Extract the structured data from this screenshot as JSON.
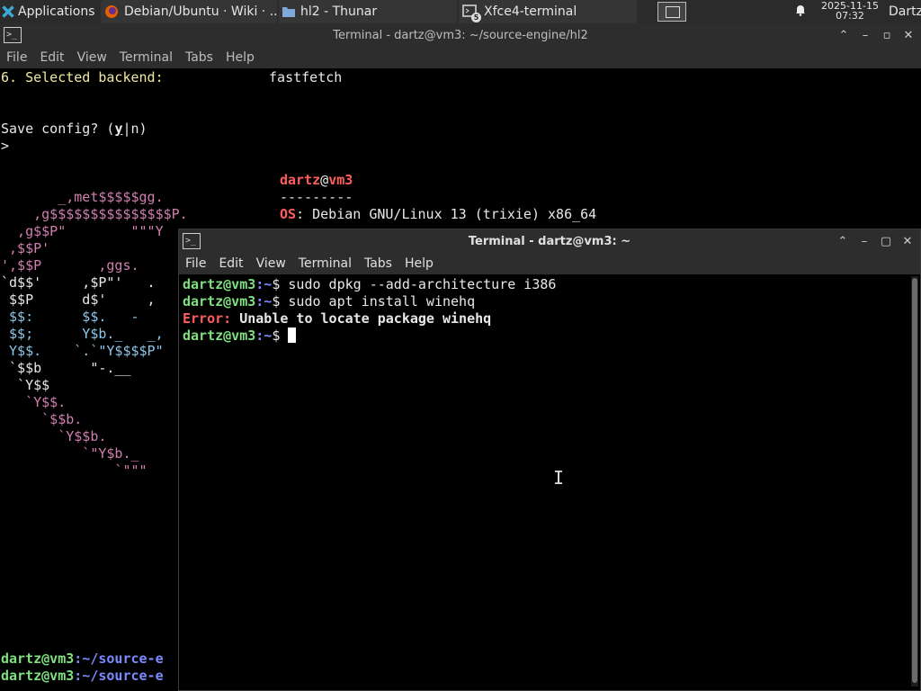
{
  "panel": {
    "applications": "Applications",
    "tasks": [
      {
        "label": "Debian/Ubuntu · Wiki · ..."
      },
      {
        "label": "hl2 - Thunar"
      },
      {
        "label": "Xfce4-terminal"
      }
    ],
    "terminal_badge": "5",
    "clock_date": "2025-11-15",
    "clock_time": "07:32",
    "user": "Dartz"
  },
  "back_window": {
    "title": "Terminal - dartz@vm3: ~/source-engine/hl2",
    "menu": [
      "File",
      "Edit",
      "View",
      "Terminal",
      "Tabs",
      "Help"
    ],
    "line_backend_label": "6. Selected backend:",
    "line_backend_value": "fastfetch",
    "save_prompt_pre": "Save config? (",
    "save_prompt_y": "y",
    "save_prompt_post": "|n)",
    "prompt_gt": ">",
    "ff_user": "dartz",
    "ff_at": "@",
    "ff_host": "vm3",
    "ff_sep": "---------",
    "ff_os_key": "OS",
    "ff_os_val": ": Debian GNU/Linux 13 (trixie) x86_64",
    "logo": [
      "       _,met$$$$$gg.",
      "    ,g$$$$$$$$$$$$$$$P.",
      "  ,g$$P\"        \"\"\"Y",
      " ,$$P'",
      "',$$P       ,ggs.",
      "`d$$'     ,$P\"'   .",
      " $$P      d$'     ,",
      " $$:      $$.   -",
      " $$;      Y$b._   _,",
      " Y$$.    `.`\"Y$$$$P\"",
      " `$$b      \"-.__",
      "  `Y$$",
      "   `Y$$.",
      "     `$$b.",
      "       `Y$$b.",
      "          `\"Y$b._",
      "              `\"\"\""
    ],
    "bottom_user": "dartz@vm3",
    "bottom_path": ":~/source-e"
  },
  "front_window": {
    "title": "Terminal - dartz@vm3: ~",
    "menu": [
      "File",
      "Edit",
      "View",
      "Terminal",
      "Tabs",
      "Help"
    ],
    "prompt_user": "dartz@vm3",
    "prompt_path": ":~",
    "prompt_sign": "$ ",
    "cmd1": "sudo dpkg --add-architecture i386",
    "cmd2": "sudo apt install winehq",
    "error_label": "Error:",
    "error_msg": " Unable to locate package winehq"
  }
}
